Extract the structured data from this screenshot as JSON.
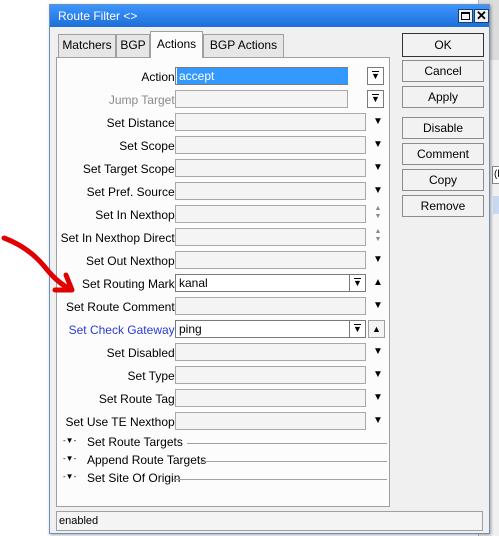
{
  "window": {
    "title": "Route Filter <>"
  },
  "tabs": [
    {
      "label": "Matchers"
    },
    {
      "label": "BGP"
    },
    {
      "label": "Actions"
    },
    {
      "label": "BGP Actions"
    }
  ],
  "fields": {
    "action": {
      "label": "Action:",
      "value": "accept"
    },
    "jump_target": {
      "label": "Jump Target:"
    },
    "set_distance": {
      "label": "Set Distance:"
    },
    "set_scope": {
      "label": "Set Scope:"
    },
    "set_target_scope": {
      "label": "Set Target Scope:"
    },
    "set_pref_source": {
      "label": "Set Pref. Source:"
    },
    "set_in_nexthop": {
      "label": "Set In Nexthop:"
    },
    "set_in_nexthop_direct": {
      "label": "Set In Nexthop Direct:"
    },
    "set_out_nexthop": {
      "label": "Set Out Nexthop:"
    },
    "set_routing_mark": {
      "label": "Set Routing Mark:",
      "value": "kanal"
    },
    "set_route_comment": {
      "label": "Set Route Comment:"
    },
    "set_check_gateway": {
      "label": "Set Check Gateway:",
      "value": "ping"
    },
    "set_disabled": {
      "label": "Set Disabled:"
    },
    "set_type": {
      "label": "Set Type:"
    },
    "set_route_tag": {
      "label": "Set Route Tag:"
    },
    "set_use_te_nexthop": {
      "label": "Set Use TE Nexthop:"
    }
  },
  "sections": [
    {
      "label": "Set Route Targets"
    },
    {
      "label": "Append Route Targets"
    },
    {
      "label": "Set Site Of Origin"
    }
  ],
  "buttons": {
    "ok": "OK",
    "cancel": "Cancel",
    "apply": "Apply",
    "disable": "Disable",
    "comment": "Comment",
    "copy": "Copy",
    "remove": "Remove"
  },
  "status": {
    "text": "enabled"
  },
  "background": {
    "cell_text": "(b"
  },
  "colors": {
    "titlebar": "#1c6fd6",
    "selection": "#3399ff",
    "link_label": "#2a3bd0",
    "annotation": "#e00000"
  }
}
